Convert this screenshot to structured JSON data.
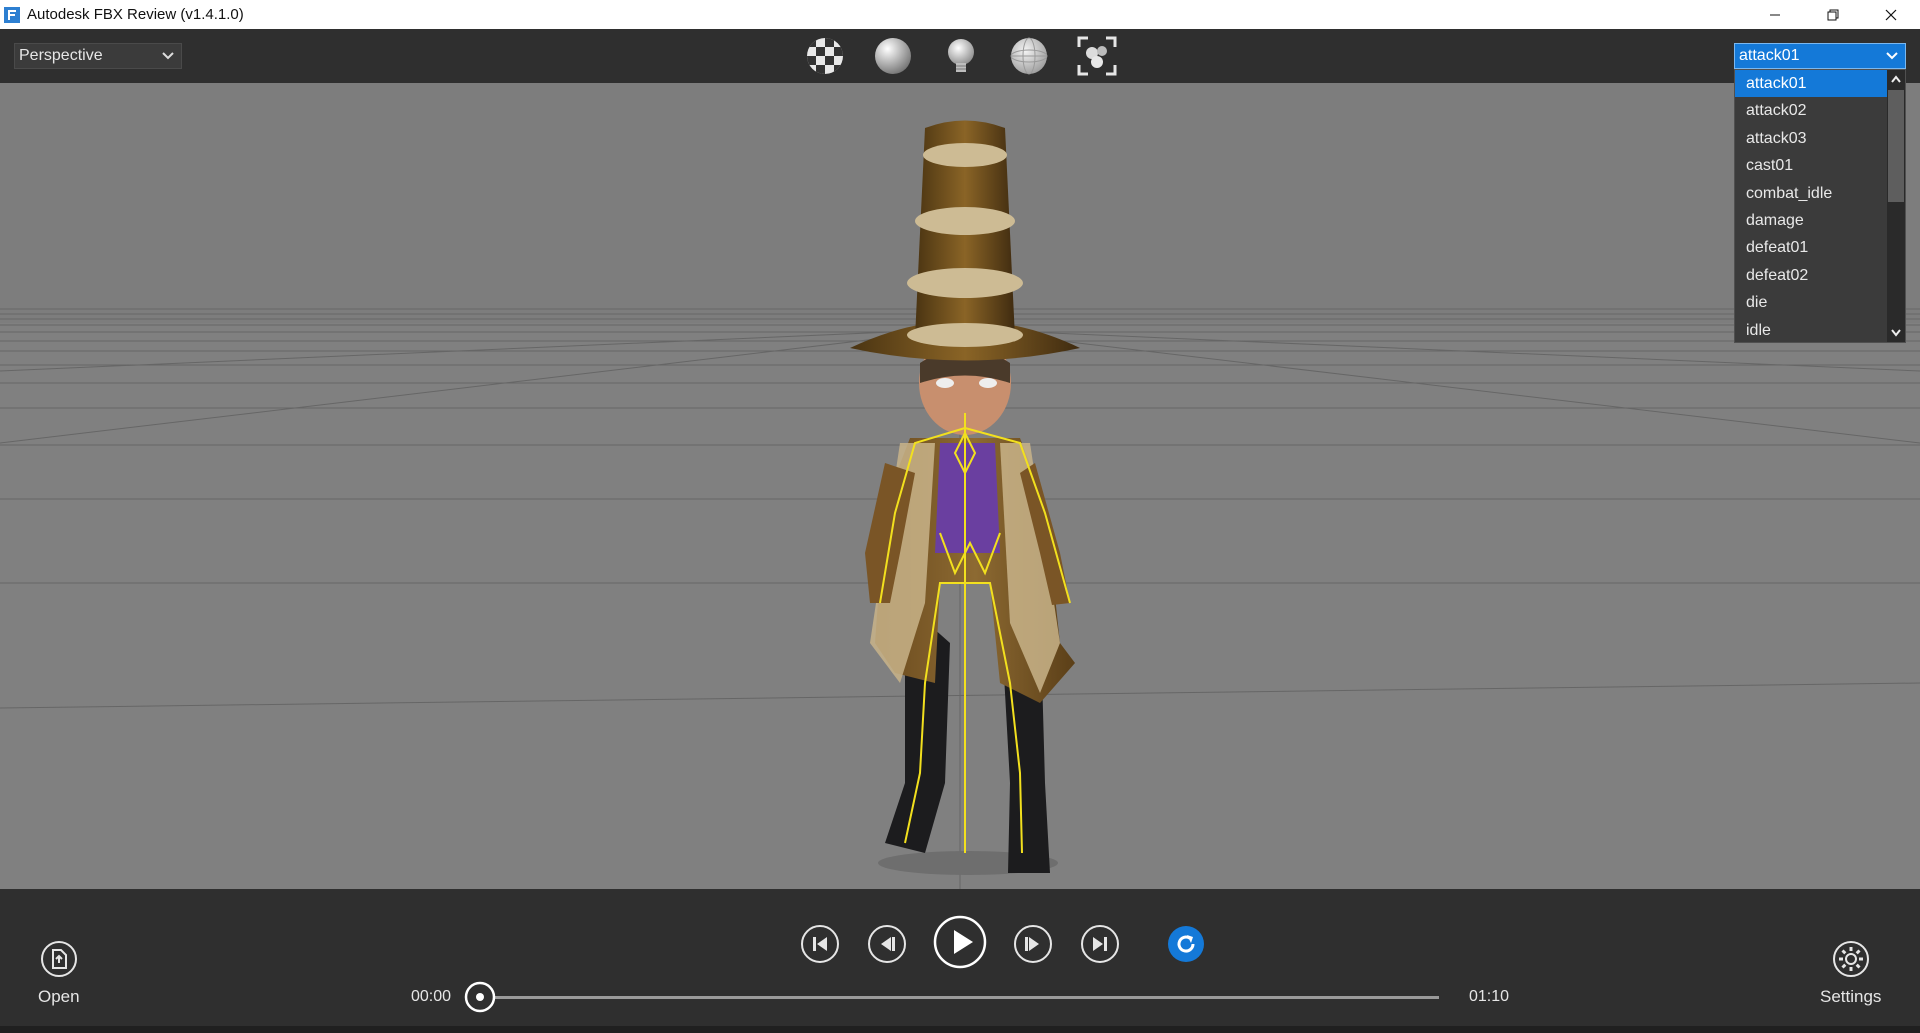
{
  "window": {
    "title": "Autodesk FBX Review (v1.4.1.0)",
    "icon": "fbx-app-icon",
    "controls": [
      "minimize-icon",
      "restore-icon",
      "close-icon"
    ]
  },
  "toolbar": {
    "view_mode": "Perspective",
    "tools": [
      "checker-texture-icon",
      "shaded-sphere-icon",
      "lightbulb-icon",
      "wireframe-sphere-icon",
      "frame-all-icon"
    ],
    "animation_select": "attack01"
  },
  "animation_dropdown": {
    "options": [
      "attack01",
      "attack02",
      "attack03",
      "cast01",
      "combat_idle",
      "damage",
      "defeat01",
      "defeat02",
      "die",
      "idle"
    ],
    "selected": "attack01"
  },
  "playback": {
    "open_label": "Open",
    "settings_label": "Settings",
    "current_time": "00:00",
    "end_time": "01:10",
    "progress": 0,
    "controls": [
      "go-to-start-icon",
      "step-back-icon",
      "play-icon",
      "step-forward-icon",
      "go-to-end-icon",
      "loop-icon"
    ]
  },
  "colors": {
    "accent": "#1479d8",
    "viewport": "#808080",
    "panel": "#2f2f2f",
    "skeleton": "#f2e01e"
  }
}
